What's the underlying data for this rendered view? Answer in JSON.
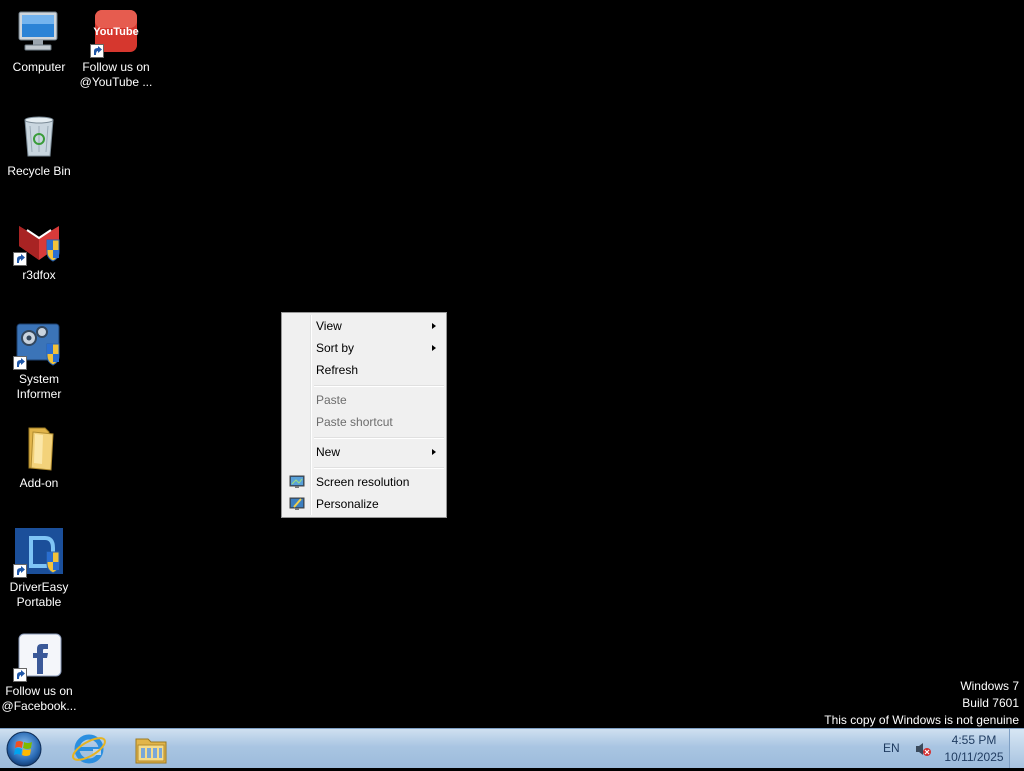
{
  "desktop": {
    "icons": [
      {
        "label": "Computer",
        "icon": "computer-icon"
      },
      {
        "label": "Follow us on @YouTube ...",
        "icon": "youtube-icon"
      },
      {
        "label": "Recycle Bin",
        "icon": "recycle-bin-icon"
      },
      {
        "label": "r3dfox",
        "icon": "r3dfox-icon"
      },
      {
        "label": "System Informer",
        "icon": "system-informer-icon"
      },
      {
        "label": "Add-on",
        "icon": "folder-icon"
      },
      {
        "label": "DriverEasy Portable",
        "icon": "drivereasy-icon"
      },
      {
        "label": "Follow us on @Facebook...",
        "icon": "facebook-icon"
      }
    ]
  },
  "youtube_logo_text": "YouTube",
  "context_menu": {
    "items": [
      {
        "label": "View",
        "submenu": true
      },
      {
        "label": "Sort by",
        "submenu": true
      },
      {
        "label": "Refresh"
      },
      {
        "label": "Paste",
        "disabled": true
      },
      {
        "label": "Paste shortcut",
        "disabled": true
      },
      {
        "label": "New",
        "submenu": true
      },
      {
        "label": "Screen resolution",
        "icon": "screen-resolution-icon"
      },
      {
        "label": "Personalize",
        "icon": "personalize-icon"
      }
    ]
  },
  "watermark": {
    "line1": "Windows 7",
    "line2": "Build 7601",
    "line3": "This copy of Windows is not genuine"
  },
  "taskbar": {
    "pinned": [
      "internet-explorer-icon",
      "windows-explorer-icon"
    ],
    "tray": {
      "language": "EN",
      "time": "4:55 PM",
      "date": "10/11/2025"
    }
  },
  "colors": {
    "desktop_bg": "#000000",
    "taskbar_top": "#cfe0f0",
    "taskbar_bottom": "#9cbbdb",
    "menu_bg": "#f0f0f0"
  }
}
